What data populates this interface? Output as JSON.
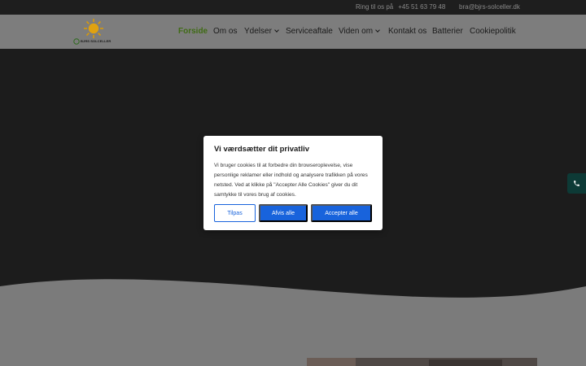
{
  "topbar": {
    "phone_label": "Ring til os på",
    "phone_number": "+45 51 63 79 48",
    "email": "bra@bjrs-solceller.dk"
  },
  "logo": {
    "brand_text": "BJRS SOLCELLER"
  },
  "nav": {
    "items": [
      {
        "label": "Forside"
      },
      {
        "label": "Om os"
      },
      {
        "label": "Ydelser"
      },
      {
        "label": "Serviceaftale"
      },
      {
        "label": "Viden om"
      },
      {
        "label": "Kontakt os"
      },
      {
        "label": "Batterier"
      },
      {
        "label": "Cookiepolitik"
      }
    ]
  },
  "cookie_modal": {
    "title": "Vi værdsætter dit privatliv",
    "body": "Vi bruger cookies til at forbedre din browseroplevelse, vise personlige reklamer eller indhold og analysere trafikken på vores netsted. Ved at klikke på \"Accepter Alle Cookies\" giver du dit samtykke til vores brug af cookies.",
    "customize_label": "Tilpas",
    "reject_label": "Afvis alle",
    "accept_label": "Accepter alle"
  },
  "colors": {
    "accent": "#1863dc",
    "nav_active": "#3f6b14",
    "call_button": "#0d3a36"
  },
  "icons": {
    "logo": "sun-logo-icon",
    "call": "phone-icon",
    "dropdown": "chevron-down-icon"
  }
}
